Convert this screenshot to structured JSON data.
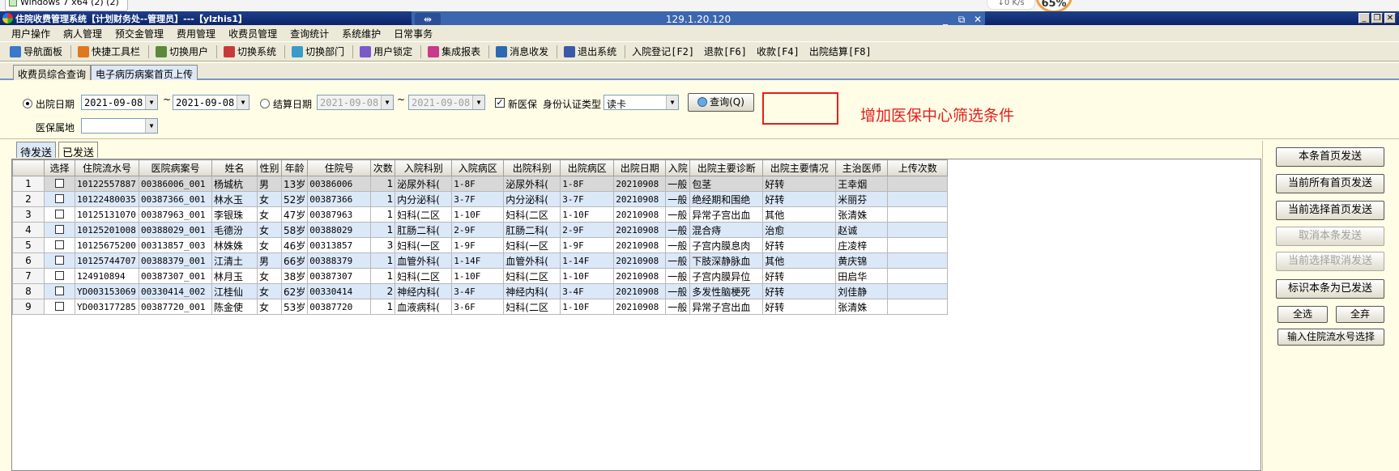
{
  "host": {
    "tab_title": "Windows 7 x64 (2) (2)",
    "net_speed": "↓0 K/s",
    "cpu_percent": "65%"
  },
  "rdp": {
    "host_ip": "129.1.20.120",
    "pin_glyph": "⇹",
    "min": "_",
    "restore": "⧉",
    "close": "✕"
  },
  "window": {
    "title": "住院收费管理系统【计划财务处--管理员】---【ylzhis1】",
    "min": "_",
    "max": "❐",
    "close": "✕"
  },
  "menu": [
    "用户操作",
    "病人管理",
    "预交金管理",
    "费用管理",
    "收费员管理",
    "查询统计",
    "系统维护",
    "日常事务"
  ],
  "toolbar": {
    "items": [
      {
        "label": "导航面板",
        "icon": "nav-panel-icon",
        "color": "#3a78c8"
      },
      {
        "label": "快捷工具栏",
        "icon": "quick-tools-icon",
        "color": "#e07820"
      },
      {
        "label": "切换用户",
        "icon": "switch-user-icon",
        "color": "#5a8a3a"
      },
      {
        "label": "切换系统",
        "icon": "switch-system-icon",
        "color": "#c83a3a"
      },
      {
        "label": "切换部门",
        "icon": "switch-dept-icon",
        "color": "#3a9ac8"
      },
      {
        "label": "用户锁定",
        "icon": "user-lock-icon",
        "color": "#7a5ac8"
      },
      {
        "label": "集成报表",
        "icon": "report-icon",
        "color": "#c83a8a"
      },
      {
        "label": "消息收发",
        "icon": "message-icon",
        "color": "#2a6ab0"
      },
      {
        "label": "退出系统",
        "icon": "exit-icon",
        "color": "#3a5aa8"
      }
    ],
    "shortcuts": [
      "入院登记[F2]",
      "退款[F6]",
      "收款[F4]",
      "出院结算[F8]"
    ]
  },
  "doc_tabs": [
    "收费员综合查询",
    "电子病历病案首页上传"
  ],
  "filter": {
    "discharge_date_label": "出院日期",
    "discharge_from": "2021-09-08",
    "discharge_to": "2021-09-08",
    "range_sep": "~",
    "settle_date_label": "结算日期",
    "settle_from": "2021-09-08",
    "settle_to": "2021-09-08",
    "new_insurance_label": "新医保",
    "id_type_label": "身份认证类型",
    "id_type_value": "读卡",
    "query_label": "查询(Q)",
    "insurance_region_label": "医保属地",
    "insurance_region_value": "",
    "check_mark": "✓",
    "dropdown_arrow": "▼"
  },
  "annotation": {
    "text": "增加医保中心筛选条件",
    "color": "#e0201c"
  },
  "sub_tabs": [
    "待发送",
    "已发送"
  ],
  "grid": {
    "columns": [
      "",
      "选择",
      "住院流水号",
      "医院病案号",
      "姓名",
      "性别",
      "年龄",
      "住院号",
      "次数",
      "入院科别",
      "入院病区",
      "出院科别",
      "出院病区",
      "出院日期",
      "入院",
      "出院主要诊断",
      "出院主要情况",
      "主治医师",
      "上传次数"
    ],
    "rows": [
      [
        "1",
        "10122557887",
        "00386006_001",
        "杨城杭",
        "男",
        "13岁",
        "00386006",
        "1",
        "泌尿外科(",
        "1-8F",
        "泌尿外科(",
        "1-8F",
        "20210908",
        "一般",
        "包茎",
        "好转",
        "王幸烟",
        ""
      ],
      [
        "2",
        "10122480035",
        "00387366_001",
        "林水玉",
        "女",
        "52岁",
        "00387366",
        "1",
        "内分泌科(",
        "3-7F",
        "内分泌科(",
        "3-7F",
        "20210908",
        "一般",
        "绝经期和围绝",
        "好转",
        "米丽芬",
        ""
      ],
      [
        "3",
        "10125131070",
        "00387963_001",
        "李银珠",
        "女",
        "47岁",
        "00387963",
        "1",
        "妇科(二区",
        "1-10F",
        "妇科(二区",
        "1-10F",
        "20210908",
        "一般",
        "异常子宫出血",
        "其他",
        "张清姝",
        ""
      ],
      [
        "4",
        "10125201008",
        "00388029_001",
        "毛德汾",
        "女",
        "58岁",
        "00388029",
        "1",
        "肛肠二科(",
        "2-9F",
        "肛肠二科(",
        "2-9F",
        "20210908",
        "一般",
        "混合痔",
        "治愈",
        "赵诚",
        ""
      ],
      [
        "5",
        "10125675200",
        "00313857_003",
        "林姝姝",
        "女",
        "46岁",
        "00313857",
        "3",
        "妇科(一区",
        "1-9F",
        "妇科(一区",
        "1-9F",
        "20210908",
        "一般",
        "子宫内膜息肉",
        "好转",
        "庄凌梓",
        ""
      ],
      [
        "6",
        "10125744707",
        "00388379_001",
        "江清土",
        "男",
        "66岁",
        "00388379",
        "1",
        "血管外科(",
        "1-14F",
        "血管外科(",
        "1-14F",
        "20210908",
        "一般",
        "下肢深静脉血",
        "其他",
        "黄庆锦",
        ""
      ],
      [
        "7",
        "124910894",
        "00387307_001",
        "林月玉",
        "女",
        "38岁",
        "00387307",
        "1",
        "妇科(二区",
        "1-10F",
        "妇科(二区",
        "1-10F",
        "20210908",
        "一般",
        "子宫内膜异位",
        "好转",
        "田启华",
        ""
      ],
      [
        "8",
        "YD003153069",
        "00330414_002",
        "江桂仙",
        "女",
        "62岁",
        "00330414",
        "2",
        "神经内科(",
        "3-4F",
        "神经内科(",
        "3-4F",
        "20210908",
        "一般",
        "多发性脑梗死",
        "好转",
        "刘佳静",
        ""
      ],
      [
        "9",
        "YD003177285",
        "00387720_001",
        "陈金使",
        "女",
        "53岁",
        "00387720",
        "1",
        "血液病科(",
        "3-6F",
        "妇科(二区",
        "1-10F",
        "20210908",
        "一般",
        "异常子宫出血",
        "好转",
        "张清姝",
        ""
      ]
    ]
  },
  "actions": {
    "send_current": "本条首页发送",
    "send_all": "当前所有首页发送",
    "send_selected": "当前选择首页发送",
    "cancel_current": "取消本条发送",
    "cancel_selected": "当前选择取消发送",
    "mark_sent": "标识本条为已发送",
    "select_all": "全选",
    "deselect_all": "全弃",
    "input_serial": "输入住院流水号选择"
  }
}
